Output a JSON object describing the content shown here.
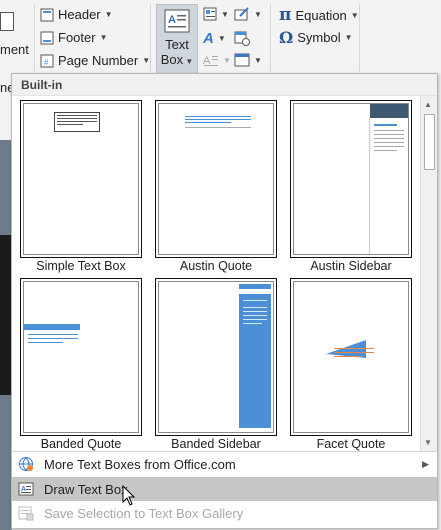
{
  "ribbon": {
    "header_label": "Header",
    "footer_label": "Footer",
    "page_number_label": "Page Number",
    "text_box_label_1": "Text",
    "text_box_label_2": "Box",
    "equation_label": "Equation",
    "symbol_label": "Symbol",
    "left_fragment_1": "ment",
    "left_fragment_2": "ne",
    "pi_glyph": "π",
    "omega_glyph": "Ω"
  },
  "gallery": {
    "section_label": "Built-in",
    "items": [
      {
        "label": "Simple Text Box"
      },
      {
        "label": "Austin Quote"
      },
      {
        "label": "Austin Sidebar"
      },
      {
        "label": "Banded Quote"
      },
      {
        "label": "Banded Sidebar"
      },
      {
        "label": "Facet Quote"
      }
    ]
  },
  "menu": {
    "more_label": "More Text Boxes from Office.com",
    "draw_label": "Draw Text Box",
    "save_label": "Save Selection to Text Box Gallery"
  },
  "colors": {
    "accent_blue": "#4a8fd8",
    "austin_dark": "#3d5a72",
    "facet_orange": "#e8863a"
  }
}
